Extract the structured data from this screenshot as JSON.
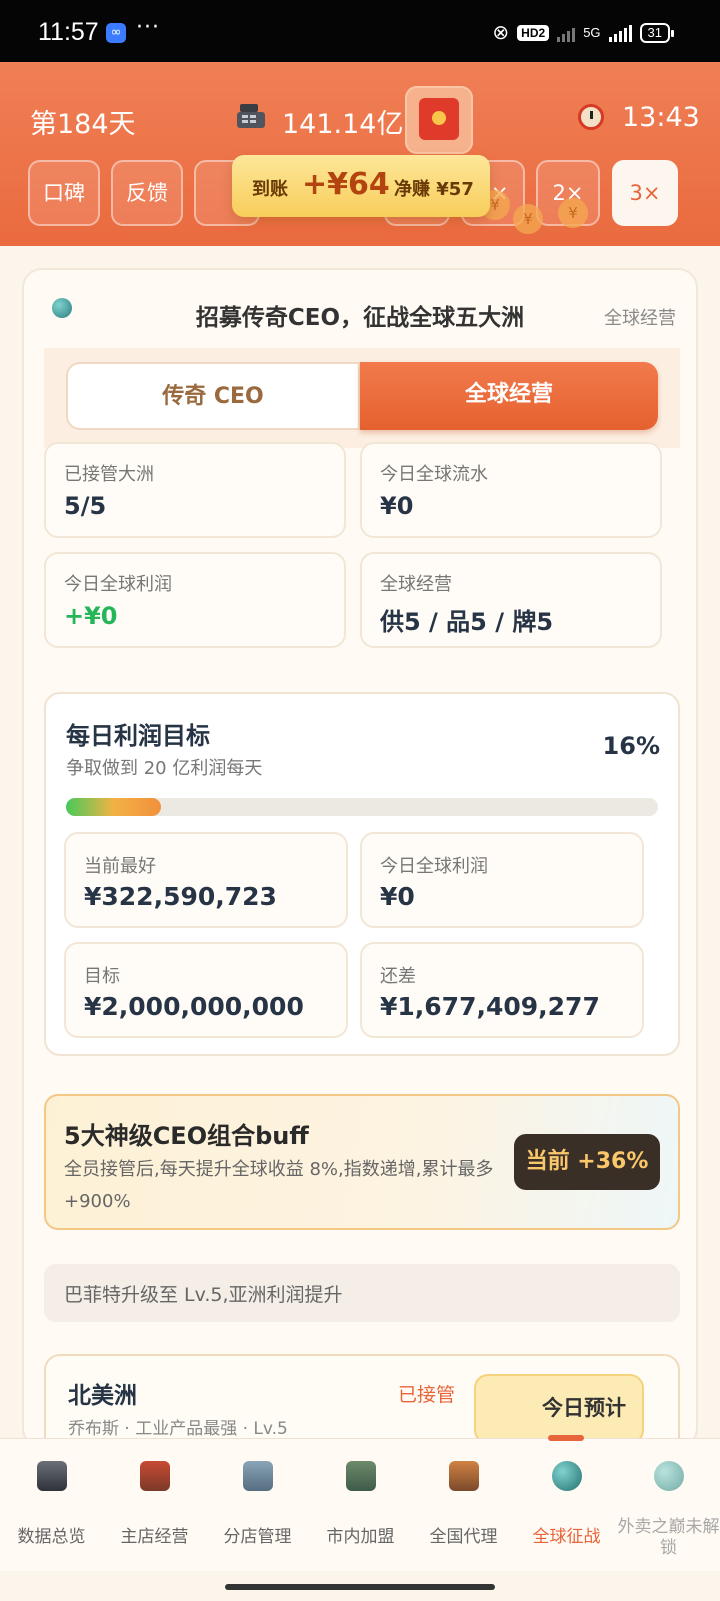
{
  "status_bar": {
    "time": "11:57",
    "dots": "···",
    "hd": "HD2",
    "network": "5G",
    "battery": "31"
  },
  "header": {
    "day": "第184天",
    "money": "141.14亿",
    "timer": "13:43",
    "chips": [
      "口碑",
      "反馈",
      "",
      "",
      "1×",
      "2×",
      "3×"
    ],
    "active_speed": "3×",
    "coin_symbol": "¥"
  },
  "toast": {
    "arrived_label": "到账",
    "amount": "+¥64",
    "net_label": "净赚 ¥57"
  },
  "card": {
    "title": "招募传奇CEO，征战全球五大洲",
    "subtitle": "全球经营",
    "tabs": {
      "left": "传奇 CEO",
      "right": "全球经营"
    },
    "stats": [
      {
        "label": "已接管大洲",
        "value": "5/5"
      },
      {
        "label": "今日全球流水",
        "value": "¥0"
      },
      {
        "label": "今日全球利润",
        "value": "+¥0"
      },
      {
        "label": "全球经营",
        "value": "供5 / 品5 / 牌5"
      }
    ],
    "goal": {
      "title": "每日利润目标",
      "subtitle": "争取做到 20 亿利润每天",
      "percent_text": "16%",
      "progress": 0.16,
      "boxes": [
        {
          "label": "当前最好",
          "value": "¥322,590,723"
        },
        {
          "label": "今日全球利润",
          "value": "¥0"
        },
        {
          "label": "目标",
          "value": "¥2,000,000,000"
        },
        {
          "label": "还差",
          "value": "¥1,677,409,277"
        }
      ]
    },
    "buff": {
      "title": "5大神级CEO组合buff",
      "desc": "全员接管后,每天提升全球收益 8%,指数递增,累计最多 +900%",
      "badge": "当前 +36%"
    },
    "notice": "巴菲特升级至 Lv.5,亚洲利润提升",
    "continent": {
      "name": "北美洲",
      "status": "已接管",
      "button": "今日预计",
      "sub": "乔布斯 · 工业产品最强 · Lv.5"
    }
  },
  "nav": {
    "items": [
      {
        "label": "数据总览",
        "icon": "cash-register-icon"
      },
      {
        "label": "主店经营",
        "icon": "store-icon"
      },
      {
        "label": "分店管理",
        "icon": "branch-store-icon"
      },
      {
        "label": "市内加盟",
        "icon": "city-franchise-icon"
      },
      {
        "label": "全国代理",
        "icon": "national-agent-icon"
      },
      {
        "label": "全球征战",
        "icon": "globe-icon"
      },
      {
        "label": "外卖之巅未解锁",
        "icon": "globe-locked-icon"
      }
    ],
    "active_index": 5,
    "colors": {
      "accent": "#e8643a",
      "header": "#ec6f44",
      "locked": "#a8a8a8"
    }
  }
}
